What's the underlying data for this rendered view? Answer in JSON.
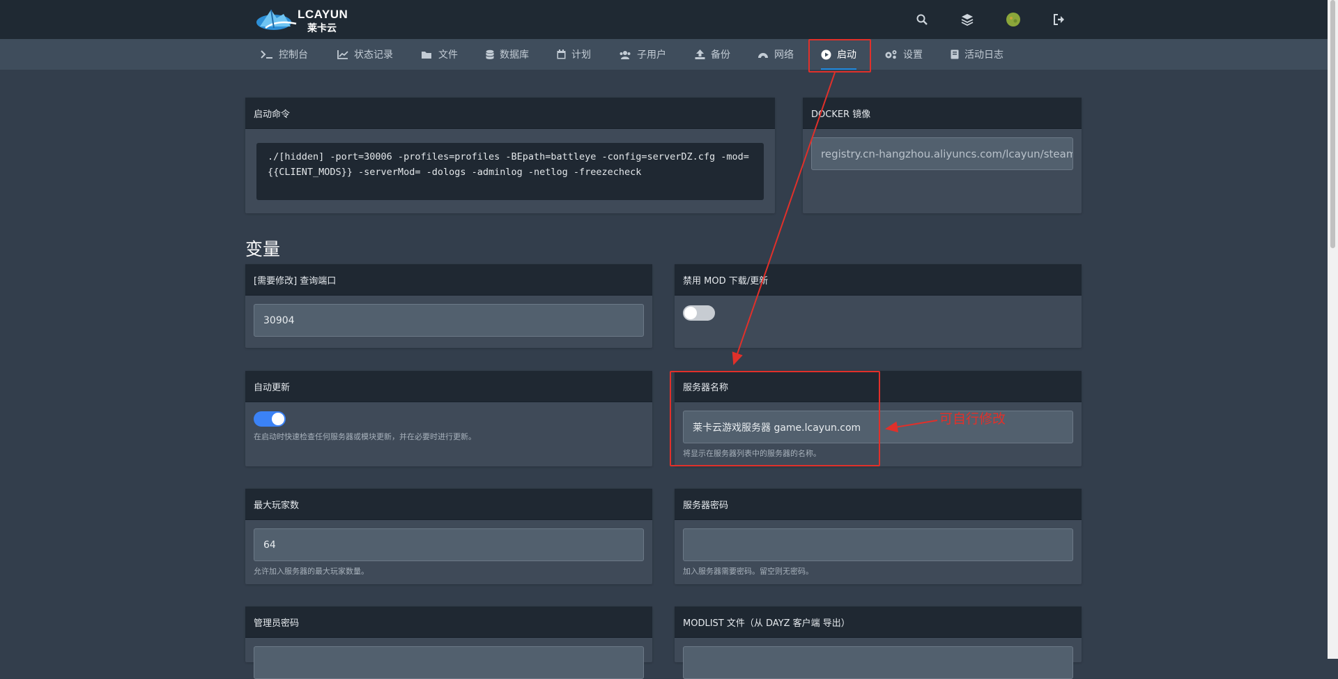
{
  "brand": {
    "name": "LCAYUN",
    "name_cn": "莱卡云"
  },
  "tabs": [
    {
      "label": "控制台",
      "icon": "terminal-icon"
    },
    {
      "label": "状态记录",
      "icon": "line-chart-icon"
    },
    {
      "label": "文件",
      "icon": "folder-icon"
    },
    {
      "label": "数据库",
      "icon": "database-icon"
    },
    {
      "label": "计划",
      "icon": "calendar-icon"
    },
    {
      "label": "子用户",
      "icon": "users-icon"
    },
    {
      "label": "备份",
      "icon": "upload-icon"
    },
    {
      "label": "网络",
      "icon": "network-icon"
    },
    {
      "label": "启动",
      "icon": "play-circle-icon"
    },
    {
      "label": "设置",
      "icon": "gears-icon"
    },
    {
      "label": "活动日志",
      "icon": "book-icon"
    }
  ],
  "startup": {
    "title": "启动命令",
    "command": "./[hidden] -port=30006 -profiles=profiles -BEpath=battleye -config=serverDZ.cfg -mod={{CLIENT_MODS}} -serverMod= -dologs -adminlog -netlog -freezecheck"
  },
  "docker": {
    "title": "DOCKER 镜像",
    "value": "registry.cn-hangzhou.aliyuncs.com/lcayun/steamcmd:dayz"
  },
  "variables_title": "变量",
  "variables": {
    "query_port": {
      "title": "[需要修改] 查询端口",
      "value": "30904"
    },
    "disable_mod": {
      "title": "禁用 MOD 下载/更新"
    },
    "auto_update": {
      "title": "自动更新",
      "description": "在启动时快速检查任何服务器或模块更新，并在必要时进行更新。"
    },
    "server_name": {
      "title": "服务器名称",
      "value": "莱卡云游戏服务器 game.lcayun.com",
      "description": "将显示在服务器列表中的服务器的名称。"
    },
    "max_players": {
      "title": "最大玩家数",
      "value": "64",
      "description": "允许加入服务器的最大玩家数量。"
    },
    "server_password": {
      "title": "服务器密码",
      "value": "",
      "description": "加入服务器需要密码。留空则无密码。"
    },
    "admin_password": {
      "title": "管理员密码"
    },
    "modlist": {
      "title": "MODLIST 文件（从 DAYZ 客户端 导出）"
    }
  },
  "annotation": "可自行修改",
  "colors": {
    "accent": "#1f8ae0",
    "annotation": "#e1302a",
    "toggle_on": "#3b82f6",
    "toggle_off": "#c7ccd2"
  }
}
